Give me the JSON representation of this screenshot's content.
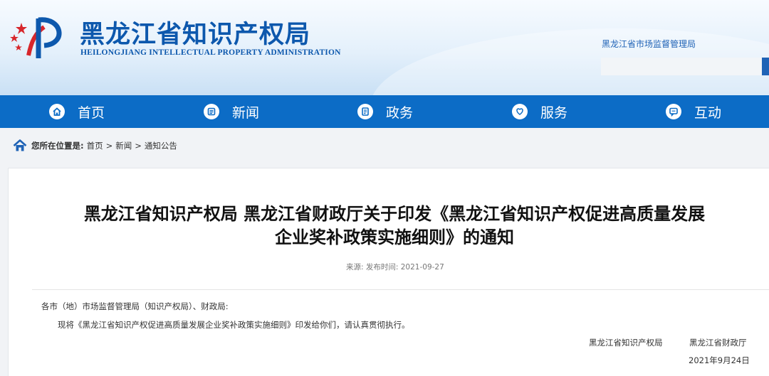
{
  "header": {
    "site_title": "黑龙江省知识产权局",
    "site_subtitle": "HEILONGJIANG INTELLECTUAL PROPERTY ADMINISTRATION",
    "top_link": "黑龙江省市场监督管理局",
    "search_placeholder": "",
    "brand_color": "#0d58ad"
  },
  "nav": {
    "bg_color": "#0c6cc6",
    "items": [
      {
        "label": "首页",
        "icon": "home-icon"
      },
      {
        "label": "新闻",
        "icon": "newspaper-icon"
      },
      {
        "label": "政务",
        "icon": "document-icon"
      },
      {
        "label": "服务",
        "icon": "heart-hand-icon"
      },
      {
        "label": "互动",
        "icon": "chat-icon"
      }
    ]
  },
  "breadcrumb": {
    "prefix": "您所在位置是:",
    "items": [
      "首页",
      "新闻",
      "通知公告"
    ],
    "separator": ">"
  },
  "article": {
    "title_line1": "黑龙江省知识产权局 黑龙江省财政厅关于印发《黑龙江省知识产权促进高质量发展",
    "title_line2": "企业奖补政策实施细则》的通知",
    "meta": "来源: 发布时间: 2021-09-27",
    "salutation": "各市（地）市场监督管理局（知识产权局）、财政局:",
    "body": "现将《黑龙江省知识产权促进高质量发展企业奖补政策实施细则》印发给你们，请认真贯彻执行。",
    "signers": [
      "黑龙江省知识产权局",
      "黑龙江省财政厅"
    ],
    "date": "2021年9月24日"
  }
}
